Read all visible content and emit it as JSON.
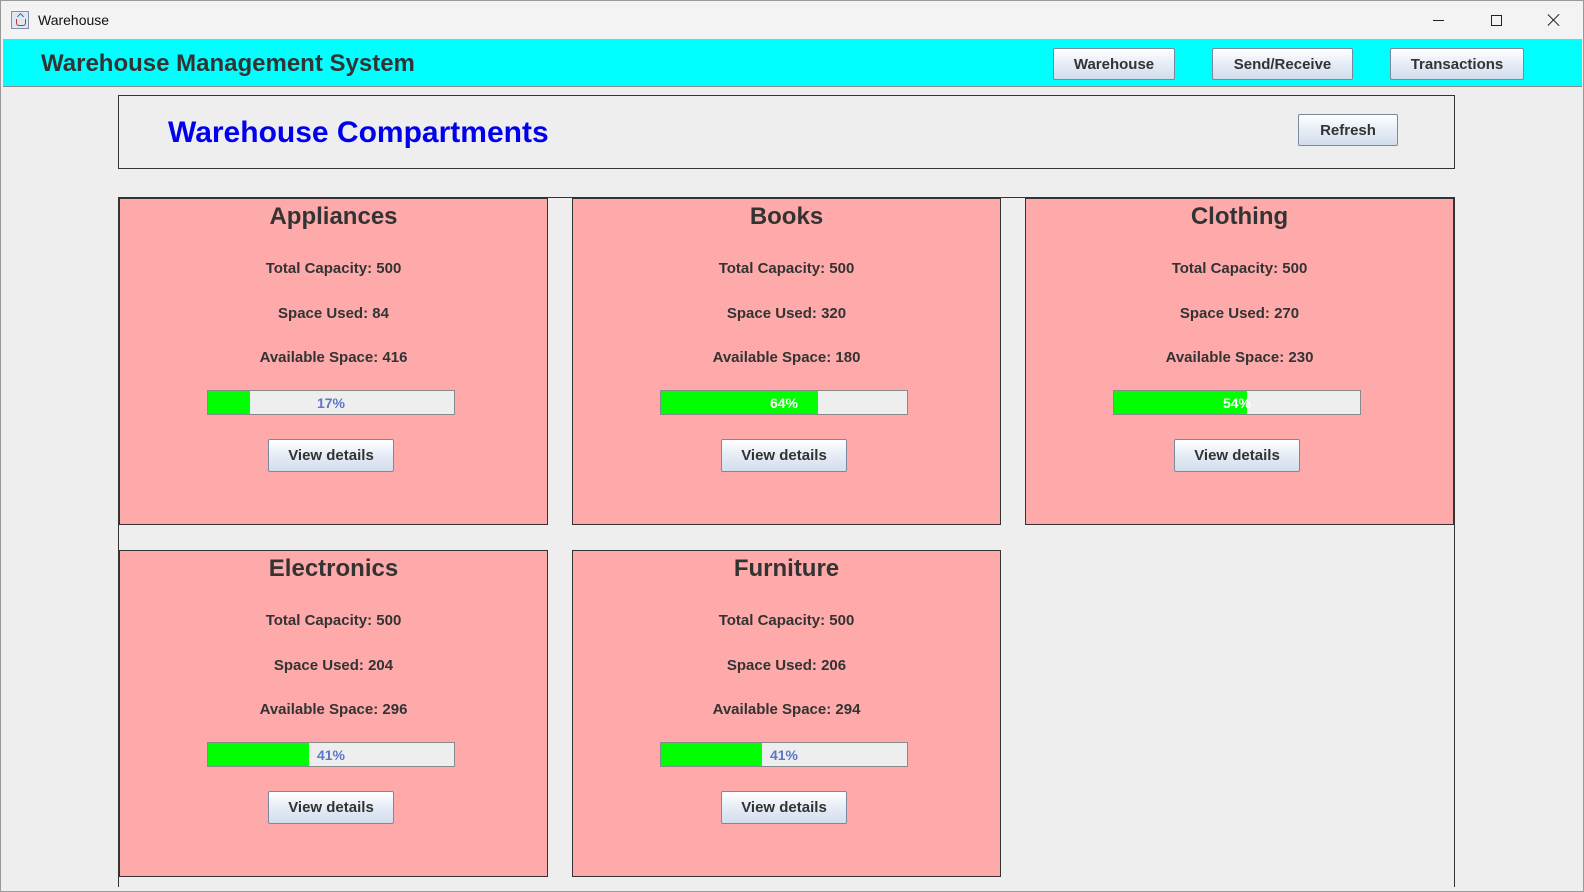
{
  "window": {
    "title": "Warehouse",
    "icon": "java-cup-icon"
  },
  "header": {
    "title": "Warehouse Management System",
    "background": "#00ffff",
    "nav": [
      {
        "label": "Warehouse"
      },
      {
        "label": "Send/Receive"
      },
      {
        "label": "Transactions"
      }
    ]
  },
  "main": {
    "title": "Warehouse Compartments",
    "title_color": "#0000ee",
    "refresh_label": "Refresh"
  },
  "compartments": [
    {
      "name": "Appliances",
      "total": "Total Capacity: 500",
      "used": "Space Used: 84",
      "available": "Available Space: 416",
      "percent": 17,
      "percent_label": "17%",
      "button": "View details"
    },
    {
      "name": "Books",
      "total": "Total Capacity: 500",
      "used": "Space Used: 320",
      "available": "Available Space: 180",
      "percent": 64,
      "percent_label": "64%",
      "button": "View details"
    },
    {
      "name": "Clothing",
      "total": "Total Capacity: 500",
      "used": "Space Used: 270",
      "available": "Available Space: 230",
      "percent": 54,
      "percent_label": "54%",
      "button": "View details"
    },
    {
      "name": "Electronics",
      "total": "Total Capacity: 500",
      "used": "Space Used: 204",
      "available": "Available Space: 296",
      "percent": 41,
      "percent_label": "41%",
      "button": "View details"
    },
    {
      "name": "Furniture",
      "total": "Total Capacity: 500",
      "used": "Space Used: 206",
      "available": "Available Space: 294",
      "percent": 41,
      "percent_label": "41%",
      "button": "View details"
    }
  ],
  "colors": {
    "card_background": "#ffaaaa",
    "progress_fill": "#00ff00",
    "progress_text": "#5a78c8"
  }
}
